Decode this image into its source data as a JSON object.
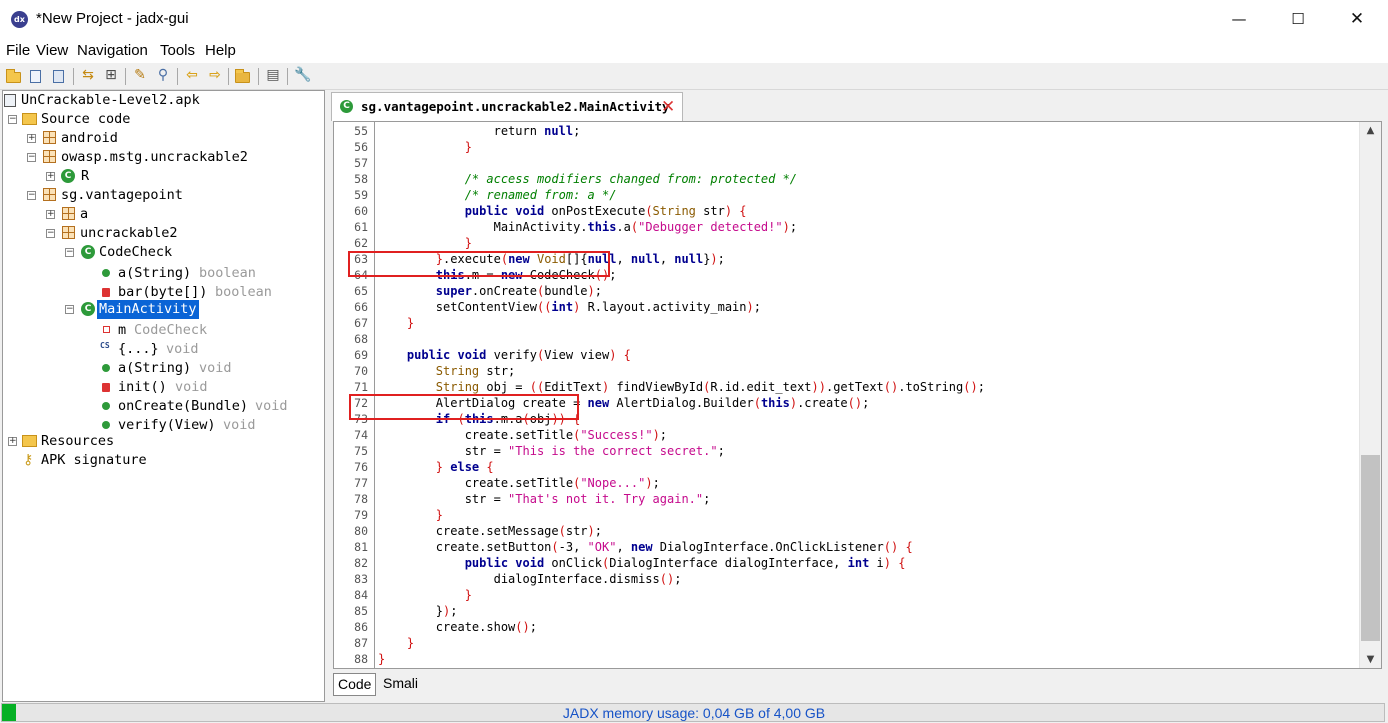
{
  "window": {
    "title": "*New Project - jadx-gui",
    "icon": "jadx-app-icon",
    "controls": {
      "minimize": "—",
      "maximize": "☐",
      "close": "✕"
    }
  },
  "menu": [
    "File",
    "View",
    "Navigation",
    "Tools",
    "Help"
  ],
  "toolbar": {
    "icons": [
      "open-folder-icon",
      "add-files-icon",
      "save-all-icon",
      "sync-icon",
      "flatten-packages-icon",
      "wand-icon",
      "search-icon",
      "back-arrow-icon",
      "forward-arrow-icon",
      "decompile-all-icon",
      "log-icon",
      "preferences-icon"
    ]
  },
  "tree": {
    "root": "UnCrackable-Level2.apk",
    "source_code": "Source code",
    "android": "android",
    "owasp_pkg": "owasp.mstg.uncrackable2",
    "owasp_r": "R",
    "sg_pkg": "sg.vantagepoint",
    "a_pkg": "a",
    "uncrackable2": "uncrackable2",
    "codecheck": "CodeCheck",
    "cc_a": "a(String)",
    "cc_a_type": "boolean",
    "cc_bar": "bar(byte[])",
    "cc_bar_type": "boolean",
    "mainactivity": "MainActivity",
    "ma_m": "m",
    "ma_m_type": "CodeCheck",
    "ma_static": "{...}",
    "ma_static_type": "void",
    "ma_a": "a(String)",
    "ma_a_type": "void",
    "ma_init": "init()",
    "ma_init_type": "void",
    "ma_oncreate": "onCreate(Bundle)",
    "ma_oncreate_type": "void",
    "ma_verify": "verify(View)",
    "ma_verify_type": "void",
    "resources": "Resources",
    "apk_signature": "APK signature"
  },
  "editor": {
    "tab_title": "sg.vantagepoint.uncrackable2.MainActivity",
    "bottom_tabs": [
      "Code",
      "Smali"
    ],
    "highlighted_lines": [
      64,
      73
    ],
    "lines": [
      {
        "n": "55",
        "tokens": [
          [
            "",
            "                return "
          ],
          [
            "k",
            "null"
          ],
          [
            "",
            ";"
          ]
        ]
      },
      {
        "n": "56",
        "tokens": [
          [
            "br",
            "            }"
          ]
        ]
      },
      {
        "n": "57",
        "tokens": []
      },
      {
        "n": "58",
        "tokens": [
          [
            "c",
            "            /* access modifiers changed from: protected */"
          ]
        ]
      },
      {
        "n": "59",
        "tokens": [
          [
            "c",
            "            /* renamed from: a */"
          ]
        ]
      },
      {
        "n": "60",
        "tokens": [
          [
            "k",
            "            public void "
          ],
          [
            "",
            "onPostExecute"
          ],
          [
            "br",
            "("
          ],
          [
            "ty",
            "String"
          ],
          [
            "",
            " str"
          ],
          [
            "br",
            ")"
          ],
          [
            "br",
            " {"
          ]
        ]
      },
      {
        "n": "61",
        "tokens": [
          [
            "",
            "                MainActivity."
          ],
          [
            "k",
            "this"
          ],
          [
            "",
            ".a"
          ],
          [
            "br",
            "("
          ],
          [
            "s",
            "\"Debugger detected!\""
          ],
          [
            "br",
            ")"
          ],
          [
            "",
            ";"
          ]
        ]
      },
      {
        "n": "62",
        "tokens": [
          [
            "br",
            "            }"
          ]
        ]
      },
      {
        "n": "63",
        "tokens": [
          [
            "br",
            "        }"
          ],
          [
            "",
            ".execute"
          ],
          [
            "br",
            "("
          ],
          [
            "k",
            "new "
          ],
          [
            "ty",
            "Void"
          ],
          [
            "",
            "[]{"
          ],
          [
            "k",
            "null"
          ],
          [
            "",
            ", "
          ],
          [
            "k",
            "null"
          ],
          [
            "",
            ", "
          ],
          [
            "k",
            "null"
          ],
          [
            "",
            "}"
          ],
          [
            "br",
            ")"
          ],
          [
            "",
            ";"
          ]
        ]
      },
      {
        "n": "64",
        "tokens": [
          [
            "k",
            "        this"
          ],
          [
            "",
            ".m = "
          ],
          [
            "k",
            "new "
          ],
          [
            "",
            "CodeCheck"
          ],
          [
            "br",
            "()"
          ],
          [
            "",
            ";"
          ]
        ]
      },
      {
        "n": "65",
        "tokens": [
          [
            "k",
            "        super"
          ],
          [
            "",
            ".onCreate"
          ],
          [
            "br",
            "("
          ],
          [
            "",
            "bundle"
          ],
          [
            "br",
            ")"
          ],
          [
            "",
            ";"
          ]
        ]
      },
      {
        "n": "66",
        "tokens": [
          [
            "",
            "        setContentView"
          ],
          [
            "br",
            "("
          ],
          [
            "br",
            "("
          ],
          [
            "k",
            "int"
          ],
          [
            "br",
            ")"
          ],
          [
            "",
            " R.layout.activity_main"
          ],
          [
            "br",
            ")"
          ],
          [
            "",
            ";"
          ]
        ]
      },
      {
        "n": "67",
        "tokens": [
          [
            "br",
            "    }"
          ]
        ]
      },
      {
        "n": "68",
        "tokens": []
      },
      {
        "n": "69",
        "tokens": [
          [
            "k",
            "    public void "
          ],
          [
            "",
            "verify"
          ],
          [
            "br",
            "("
          ],
          [
            "",
            "View view"
          ],
          [
            "br",
            ")"
          ],
          [
            "br",
            " {"
          ]
        ]
      },
      {
        "n": "70",
        "tokens": [
          [
            "ty",
            "        String"
          ],
          [
            "",
            " str;"
          ]
        ]
      },
      {
        "n": "71",
        "tokens": [
          [
            "ty",
            "        String"
          ],
          [
            "",
            " obj = "
          ],
          [
            "br",
            "(("
          ],
          [
            "",
            "EditText"
          ],
          [
            "br",
            ")"
          ],
          [
            "",
            " findViewById"
          ],
          [
            "br",
            "("
          ],
          [
            "",
            "R.id.edit_text"
          ],
          [
            "br",
            "))"
          ],
          [
            "",
            ".getText"
          ],
          [
            "br",
            "()"
          ],
          [
            "",
            ".toString"
          ],
          [
            "br",
            "()"
          ],
          [
            "",
            ";"
          ]
        ]
      },
      {
        "n": "72",
        "tokens": [
          [
            "",
            "        AlertDialog create = "
          ],
          [
            "k",
            "new "
          ],
          [
            "",
            "AlertDialog.Builder"
          ],
          [
            "br",
            "("
          ],
          [
            "k",
            "this"
          ],
          [
            "br",
            ")"
          ],
          [
            "",
            ".create"
          ],
          [
            "br",
            "()"
          ],
          [
            "",
            ";"
          ]
        ]
      },
      {
        "n": "73",
        "tokens": [
          [
            "k",
            "        if "
          ],
          [
            "br",
            "("
          ],
          [
            "k",
            "this"
          ],
          [
            "",
            ".m.a"
          ],
          [
            "br",
            "("
          ],
          [
            "",
            "obj"
          ],
          [
            "br",
            "))"
          ],
          [
            "br",
            " {"
          ]
        ]
      },
      {
        "n": "74",
        "tokens": [
          [
            "",
            "            create.setTitle"
          ],
          [
            "br",
            "("
          ],
          [
            "s",
            "\"Success!\""
          ],
          [
            "br",
            ")"
          ],
          [
            "",
            ";"
          ]
        ]
      },
      {
        "n": "75",
        "tokens": [
          [
            "",
            "            str = "
          ],
          [
            "s",
            "\"This is the correct secret.\""
          ],
          [
            "",
            ";"
          ]
        ]
      },
      {
        "n": "76",
        "tokens": [
          [
            "br",
            "        }"
          ],
          [
            "k",
            " else "
          ],
          [
            "br",
            "{"
          ]
        ]
      },
      {
        "n": "77",
        "tokens": [
          [
            "",
            "            create.setTitle"
          ],
          [
            "br",
            "("
          ],
          [
            "s",
            "\"Nope...\""
          ],
          [
            "br",
            ")"
          ],
          [
            "",
            ";"
          ]
        ]
      },
      {
        "n": "78",
        "tokens": [
          [
            "",
            "            str = "
          ],
          [
            "s",
            "\"That's not it. Try again.\""
          ],
          [
            "",
            ";"
          ]
        ]
      },
      {
        "n": "79",
        "tokens": [
          [
            "br",
            "        }"
          ]
        ]
      },
      {
        "n": "80",
        "tokens": [
          [
            "",
            "        create.setMessage"
          ],
          [
            "br",
            "("
          ],
          [
            "",
            "str"
          ],
          [
            "br",
            ")"
          ],
          [
            "",
            ";"
          ]
        ]
      },
      {
        "n": "81",
        "tokens": [
          [
            "",
            "        create.setButton"
          ],
          [
            "br",
            "("
          ],
          [
            "",
            "-3, "
          ],
          [
            "s",
            "\"OK\""
          ],
          [
            "",
            ", "
          ],
          [
            "k",
            "new "
          ],
          [
            "",
            "DialogInterface.OnClickListener"
          ],
          [
            "br",
            "()"
          ],
          [
            "br",
            " {"
          ]
        ]
      },
      {
        "n": "82",
        "tokens": [
          [
            "k",
            "            public void "
          ],
          [
            "",
            "onClick"
          ],
          [
            "br",
            "("
          ],
          [
            "",
            "DialogInterface dialogInterface, "
          ],
          [
            "k",
            "int"
          ],
          [
            "",
            " i"
          ],
          [
            "br",
            ")"
          ],
          [
            "br",
            " {"
          ]
        ]
      },
      {
        "n": "83",
        "tokens": [
          [
            "",
            "                dialogInterface.dismiss"
          ],
          [
            "br",
            "()"
          ],
          [
            "",
            ";"
          ]
        ]
      },
      {
        "n": "84",
        "tokens": [
          [
            "br",
            "            }"
          ]
        ]
      },
      {
        "n": "85",
        "tokens": [
          [
            "",
            "        }"
          ],
          [
            "br",
            ")"
          ],
          [
            "",
            ";"
          ]
        ]
      },
      {
        "n": "86",
        "tokens": [
          [
            "",
            "        create.show"
          ],
          [
            "br",
            "()"
          ],
          [
            "",
            ";"
          ]
        ]
      },
      {
        "n": "87",
        "tokens": [
          [
            "br",
            "    }"
          ]
        ]
      },
      {
        "n": "88",
        "tokens": [
          [
            "br",
            "}"
          ]
        ]
      }
    ]
  },
  "status": {
    "memory_text": "JADX memory usage: 0,04 GB of 4,00 GB",
    "memory_used_fraction": 0.01
  }
}
